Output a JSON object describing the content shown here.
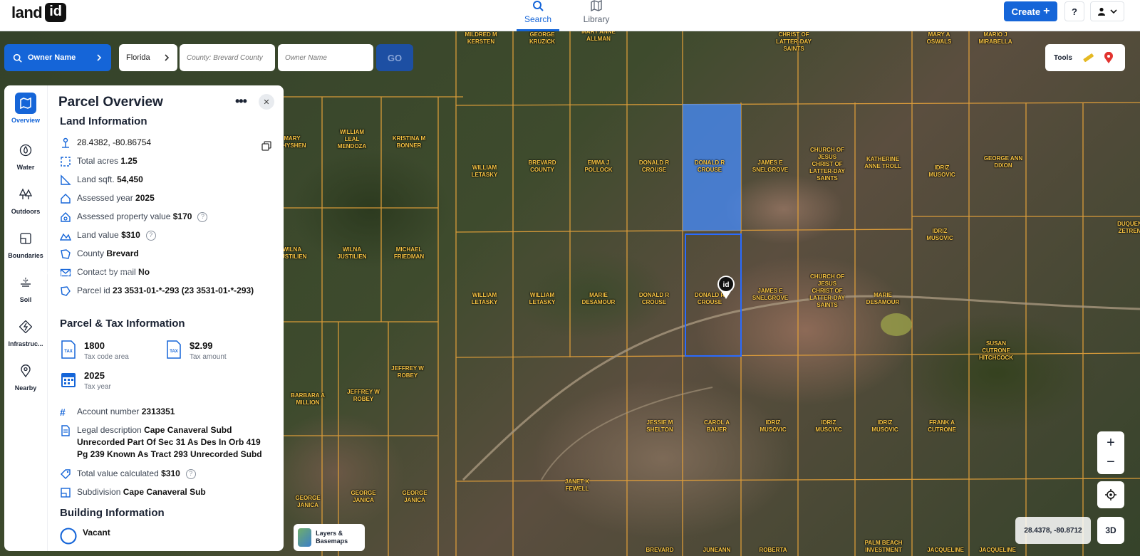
{
  "app": {
    "logo_text": "land",
    "logo_box": "id"
  },
  "nav": {
    "search": "Search",
    "library": "Library"
  },
  "header": {
    "create": "Create",
    "help": "?"
  },
  "search": {
    "mode": "Owner Name",
    "state": "Florida",
    "county_placeholder": "County: Brevard County",
    "owner_placeholder": "Owner Name",
    "go": "GO"
  },
  "tools": {
    "label": "Tools"
  },
  "rail": {
    "items": [
      {
        "label": "Overview",
        "icon": "map-icon"
      },
      {
        "label": "Water",
        "icon": "water-icon"
      },
      {
        "label": "Outdoors",
        "icon": "trees-icon"
      },
      {
        "label": "Boundaries",
        "icon": "boundaries-icon"
      },
      {
        "label": "Soil",
        "icon": "soil-icon"
      },
      {
        "label": "Infrastruc...",
        "icon": "infrastructure-icon"
      },
      {
        "label": "Nearby",
        "icon": "pin-icon"
      }
    ]
  },
  "panel": {
    "title": "Parcel Overview",
    "land_info_title": "Land Information",
    "coords": "28.4382, -80.86754",
    "total_acres_label": "Total acres",
    "total_acres": "1.25",
    "land_sqft_label": "Land sqft.",
    "land_sqft": "54,450",
    "assessed_year_label": "Assessed year",
    "assessed_year": "2025",
    "assessed_value_label": "Assessed property value",
    "assessed_value": "$170",
    "land_value_label": "Land value",
    "land_value": "$310",
    "county_label": "County",
    "county": "Brevard",
    "contact_label": "Contact by mail",
    "contact": "No",
    "parcel_id_label": "Parcel id",
    "parcel_id": "23 3531-01-*-293 (23 3531-01-*-293)",
    "tax_title": "Parcel & Tax Information",
    "tax_code": "1800",
    "tax_code_label": "Tax code area",
    "tax_amount": "$2.99",
    "tax_amount_label": "Tax amount",
    "tax_year": "2025",
    "tax_year_label": "Tax year",
    "account_label": "Account number",
    "account": "2313351",
    "legal_label": "Legal description",
    "legal": "Cape Canaveral Subd Unrecorded Part Of Sec 31 As Des In Orb 419 Pg 239 Known As Tract 293 Unrecorded Subd",
    "total_calc_label": "Total value calculated",
    "total_calc": "$310",
    "subdivision_label": "Subdivision",
    "subdivision": "Cape Canaveral Sub",
    "building_title": "Building Information",
    "building": "Vacant"
  },
  "watermark": "A12071143 - SEFMLS© 2026",
  "map": {
    "layers": "Layers & Basemaps",
    "coords": "28.4378, -80.8712",
    "btn3d": "3D",
    "zoom_in": "+",
    "zoom_out": "−",
    "owners": [
      "MILDRED M KERSTEN",
      "GEORGE KRUZICK",
      "MARY ANNE ALLMAN",
      "CHRIST OF LATTER-DAY SAINTS",
      "MARY A OSWALS",
      "MARIO J MIRABELLA",
      "MARY CHYSHEN",
      "WILLIAM LEAL MENDOZA",
      "KRISTINA M BONNER",
      "WILLIAM LETASKY",
      "BREVARD COUNTY",
      "EMMA J POLLOCK",
      "DONALD R CROUSE",
      "DONALD R CROUSE",
      "JAMES E SNELGROVE",
      "CHURCH OF JESUS CHRIST OF LATTER-DAY SAINTS",
      "KATHERINE ANNE TROLL",
      "IDRIZ MUSOVIC",
      "GEORGE ANN DIXON",
      "IDRIZ MUSOVIC",
      "DUQUENNE ZETRENNE",
      "WILNA JUSTILIEN",
      "WILNA JUSTILIEN",
      "MICHAEL FRIEDMAN",
      "WILLIAM LETASKY",
      "WILLIAM LETASKY",
      "MARIE DESAMOUR",
      "DONALD R CROUSE",
      "DONALD R CROUSE",
      "JAMES E SNELGROVE",
      "CHURCH OF JESUS CHRIST OF LATTER-DAY SAINTS",
      "MARIE DESAMOUR",
      "SUSAN CUTRONE HITCHCOCK",
      "BARBARA A MILLION",
      "JEFFREY W ROBEY",
      "JEFFREY W ROBEY",
      "JESSIE M SHELTON",
      "CAROL A BAUER",
      "IDRIZ MUSOVIC",
      "IDRIZ MUSOVIC",
      "IDRIZ MUSOVIC",
      "FRANK A CUTRONE",
      "GEORGE JANICA",
      "GEORGE JANICA",
      "GEORGE JANICA",
      "JANET K FEWELL",
      "BREVARD",
      "JUNEANN",
      "ROBERTA",
      "PALM BEACH INVESTMENT",
      "JACQUELINE",
      "JACQUELINE"
    ]
  },
  "colors": {
    "accent": "#1565d8",
    "parcel_line": "#e8a33a",
    "owner_label": "#f6c343"
  }
}
